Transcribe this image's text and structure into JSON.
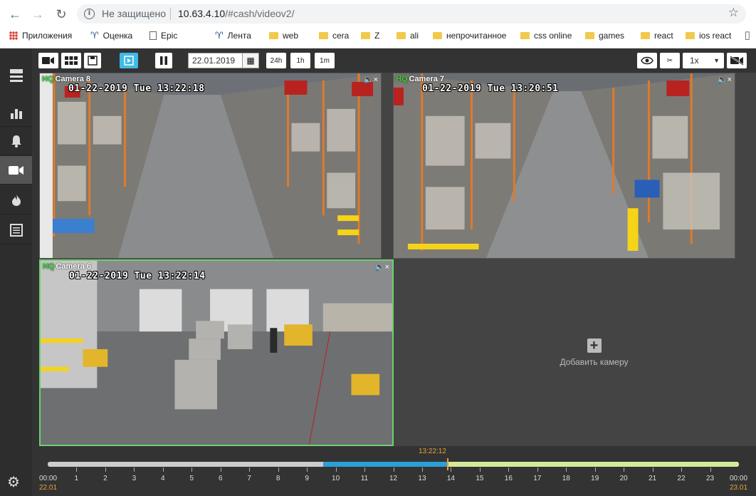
{
  "browser": {
    "insecure_label": "Не защищено",
    "url_host": "10.63.4.10",
    "url_path": "/#cash/videov2/",
    "bookmarks": [
      {
        "label": "Приложения",
        "icon": "apps-icon"
      },
      {
        "label": "Оценка",
        "icon": "mascot-icon"
      },
      {
        "label": "Epic",
        "icon": "page-icon"
      },
      {
        "label": "Лента",
        "icon": "mascot-icon"
      },
      {
        "label": "web",
        "icon": "folder-icon"
      },
      {
        "label": "cera",
        "icon": "folder-icon"
      },
      {
        "label": "Z",
        "icon": "folder-icon"
      },
      {
        "label": "ali",
        "icon": "folder-icon"
      },
      {
        "label": "непрочитанное",
        "icon": "folder-icon"
      },
      {
        "label": "css online",
        "icon": "folder-icon"
      },
      {
        "label": "games",
        "icon": "folder-icon"
      },
      {
        "label": "react",
        "icon": "folder-icon"
      },
      {
        "label": "ios react",
        "icon": "folder-icon"
      }
    ]
  },
  "sidebar": {
    "items": [
      {
        "name": "menu-icon"
      },
      {
        "name": "chart-icon"
      },
      {
        "name": "bell-icon"
      },
      {
        "name": "camera-icon",
        "active": true
      },
      {
        "name": "fire-icon"
      },
      {
        "name": "list-icon"
      }
    ],
    "settings": "gear-icon"
  },
  "toolbar": {
    "date": "22.01.2019",
    "range_24h": "24h",
    "range_1h": "1h",
    "range_1m": "1m",
    "speed": "1x"
  },
  "cameras": [
    {
      "hq": "HQ",
      "name": "Camera 8",
      "timestamp": "01-22-2019 Tue 13:22:18"
    },
    {
      "hq": "HQ",
      "name": "Camera 7",
      "timestamp": "01-22-2019 Tue 13:20:51"
    },
    {
      "hq": "HQ",
      "name": "Camera 6",
      "timestamp": "01-22-2019 Tue 13:22:14"
    }
  ],
  "add_camera": {
    "label": "Добавить камеру"
  },
  "timeline": {
    "current_time": "13:22:12",
    "start_time": "00:00",
    "start_date": "22.01",
    "end_time": "00:00",
    "end_date": "23.01",
    "hours": [
      "1",
      "2",
      "3",
      "4",
      "5",
      "6",
      "7",
      "8",
      "9",
      "10",
      "11",
      "12",
      "13",
      "14",
      "15",
      "16",
      "17",
      "18",
      "19",
      "20",
      "21",
      "22",
      "23"
    ]
  },
  "colors": {
    "accent": "#3fbbe6",
    "selected_border": "#6bd16b",
    "archive_blue": "#2a9fd8",
    "future_green": "#d4ea9a",
    "cursor": "#e8a33a"
  }
}
